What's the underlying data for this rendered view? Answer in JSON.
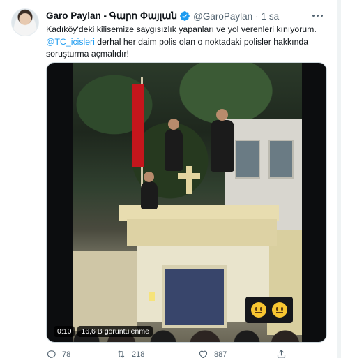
{
  "tweet": {
    "display_name": "Garo Paylan - Գարո Փայլան",
    "handle": "@GaroPaylan",
    "separator": "·",
    "time": "1 sa",
    "text_line1": "Kadıköy'deki kilisemize saygısızlık yapanları ve yol verenleri kınıyorum.",
    "mention": "@TC_icisleri",
    "text_line2_rest": " derhal her daim polis olan o noktadaki polisler hakkında",
    "text_line3": "soruşturma açmalıdır!"
  },
  "video": {
    "time_label": "0:10",
    "views_label": "16,6 B görüntülenme"
  },
  "actions": {
    "reply_count": "78",
    "retweet_count": "218",
    "like_count": "887"
  },
  "icons": {
    "verified": "verified-badge-icon",
    "more": "more-dots-icon",
    "reply": "reply-icon",
    "retweet": "retweet-icon",
    "like": "heart-icon",
    "share": "share-icon"
  },
  "colors": {
    "accent": "#1d9bf0",
    "secondary_text": "#536471",
    "flag": "#c4161c"
  }
}
